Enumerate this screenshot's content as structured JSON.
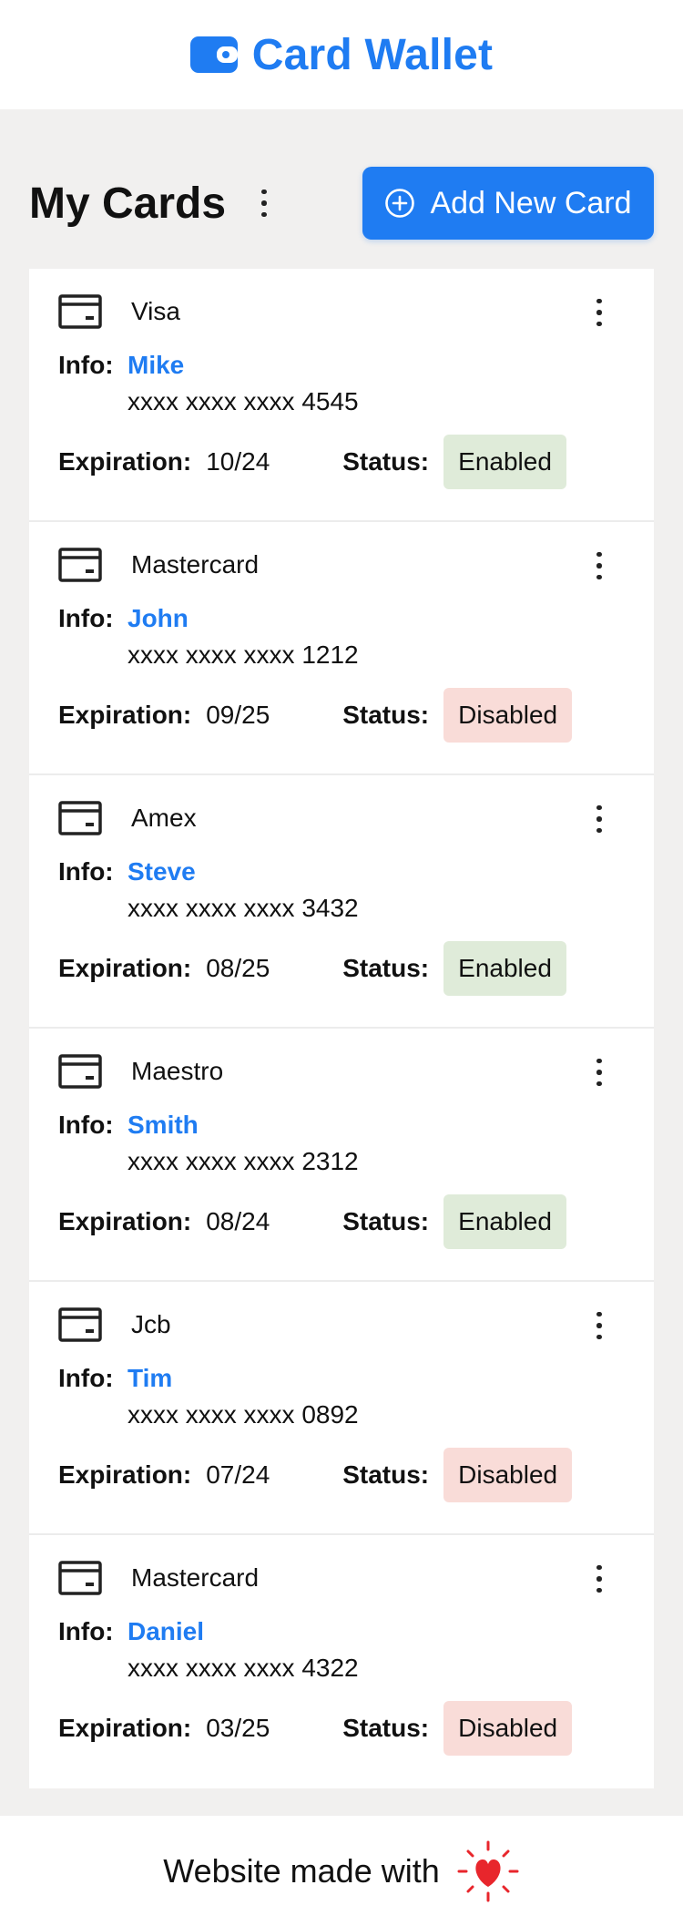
{
  "header": {
    "title": "Card Wallet",
    "icon": "wallet-icon"
  },
  "toolbar": {
    "title": "My Cards",
    "add_label": "Add New Card"
  },
  "labels": {
    "info": "Info:",
    "expiration": "Expiration:",
    "status": "Status:"
  },
  "cards": [
    {
      "brand": "Visa",
      "name": "Mike",
      "number": "xxxx xxxx xxxx 4545",
      "expiration": "10/24",
      "status": "Enabled"
    },
    {
      "brand": "Mastercard",
      "name": "John",
      "number": "xxxx xxxx xxxx 1212",
      "expiration": "09/25",
      "status": "Disabled"
    },
    {
      "brand": "Amex",
      "name": "Steve",
      "number": "xxxx xxxx xxxx 3432",
      "expiration": "08/25",
      "status": "Enabled"
    },
    {
      "brand": "Maestro",
      "name": "Smith",
      "number": "xxxx xxxx xxxx 2312",
      "expiration": "08/24",
      "status": "Enabled"
    },
    {
      "brand": "Jcb",
      "name": "Tim",
      "number": "xxxx xxxx xxxx 0892",
      "expiration": "07/24",
      "status": "Disabled"
    },
    {
      "brand": "Mastercard",
      "name": "Daniel",
      "number": "xxxx xxxx xxxx 4322",
      "expiration": "03/25",
      "status": "Disabled"
    }
  ],
  "footer": {
    "text": "Website made with",
    "icon": "heart-icon"
  },
  "colors": {
    "accent": "#1f7cf2",
    "enabled_bg": "#dfebd9",
    "disabled_bg": "#f9dcd8",
    "heart": "#e8262c"
  }
}
